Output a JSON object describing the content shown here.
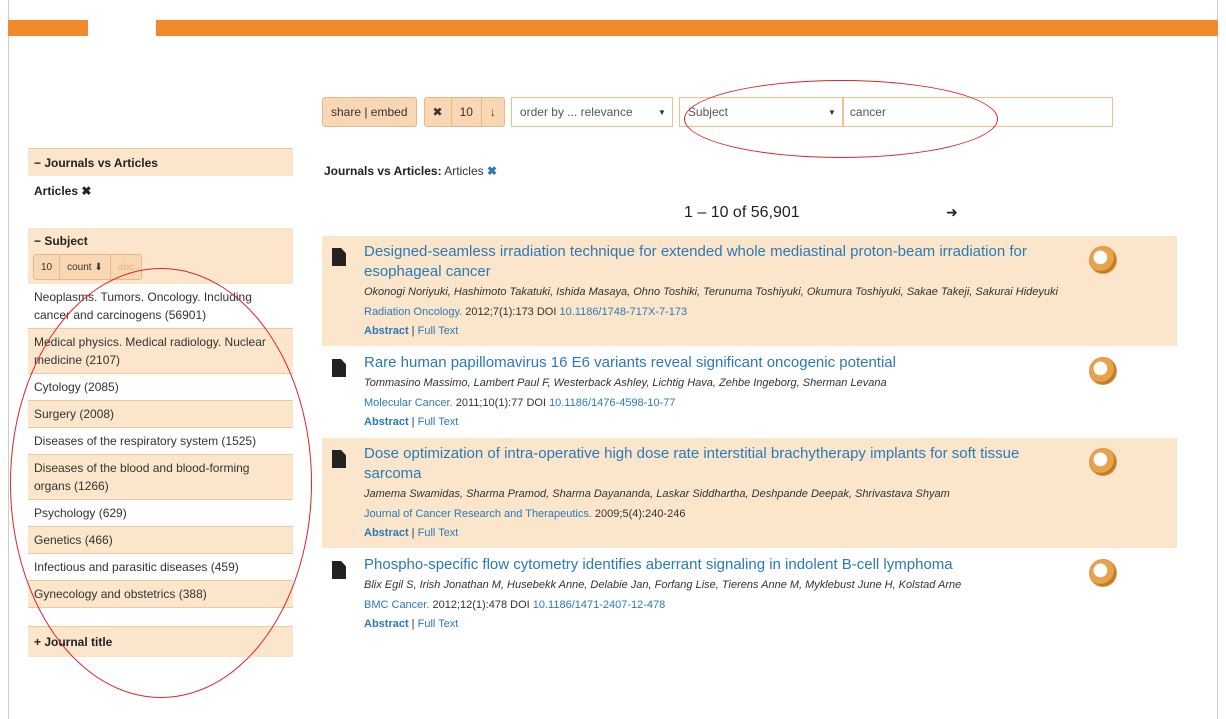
{
  "toolbar": {
    "share": "share | embed",
    "clear": "✖",
    "rows": "10",
    "down": "↓",
    "order": "order by ... relevance",
    "field": "Subject",
    "query": "cancer"
  },
  "filter": {
    "label": "Journals vs Articles:",
    "value": "Articles",
    "remove": "✖"
  },
  "pager": {
    "range": "1 – 10 of 56,901",
    "next": "➜"
  },
  "sidebar": {
    "jva_head": "− Journals vs Articles",
    "jva_active": "Articles ✖",
    "subject_head": "− Subject",
    "mini_btns": [
      "10",
      "count ⬇",
      "abc"
    ],
    "subjects": [
      "Neoplasms. Tumors. Oncology. Including cancer and carcinogens (56901)",
      "Medical physics. Medical radiology. Nuclear medicine (2107)",
      "Cytology (2085)",
      "Surgery (2008)",
      "Diseases of the respiratory system (1525)",
      "Diseases of the blood and blood-forming organs (1266)",
      "Psychology (629)",
      "Genetics (466)",
      "Infectious and parasitic diseases (459)",
      "Gynecology and obstetrics (388)"
    ],
    "journal_title": "+ Journal title"
  },
  "results": [
    {
      "title": "Designed-seamless irradiation technique for extended whole mediastinal proton-beam irradiation for esophageal cancer",
      "authors": "Okonogi Noriyuki, Hashimoto Takatuki, Ishida Masaya, Ohno Toshiki, Terunuma Toshiyuki, Okumura Toshiyuki, Sakae Takeji, Sakurai Hideyuki",
      "journal": "Radiation Oncology.",
      "cite": " 2012;7(1):173 DOI ",
      "doi": "10.1186/1748-717X-7-173"
    },
    {
      "title": "Rare human papillomavirus 16 E6 variants reveal significant oncogenic potential",
      "authors": "Tommasino Massimo, Lambert Paul F, Westerback Ashley, Lichtig Hava, Zehbe Ingeborg, Sherman Levana",
      "journal": "Molecular Cancer.",
      "cite": " 2011;10(1):77 DOI ",
      "doi": "10.1186/1476-4598-10-77"
    },
    {
      "title": "Dose optimization of intra-operative high dose rate interstitial brachytherapy implants for soft tissue sarcoma",
      "authors": "Jamema Swamidas, Sharma Pramod, Sharma Dayananda, Laskar Siddhartha, Deshpande Deepak, Shrivastava Shyam",
      "journal": "Journal of Cancer Research and Therapeutics.",
      "cite": " 2009;5(4):240-246",
      "doi": ""
    },
    {
      "title": "Phospho-specific flow cytometry identifies aberrant signaling in indolent B-cell lymphoma",
      "authors": "Blix Egil S, Irish Jonathan M, Husebekk Anne, Delabie Jan, Forfang Lise, Tierens Anne M, Myklebust June H, Kolstad Arne",
      "journal": "BMC Cancer.",
      "cite": " 2012;12(1):478 DOI ",
      "doi": "10.1186/1471-2407-12-478"
    }
  ],
  "links": {
    "abstract": "Abstract",
    "sep": " | ",
    "fulltext": "Full Text"
  }
}
